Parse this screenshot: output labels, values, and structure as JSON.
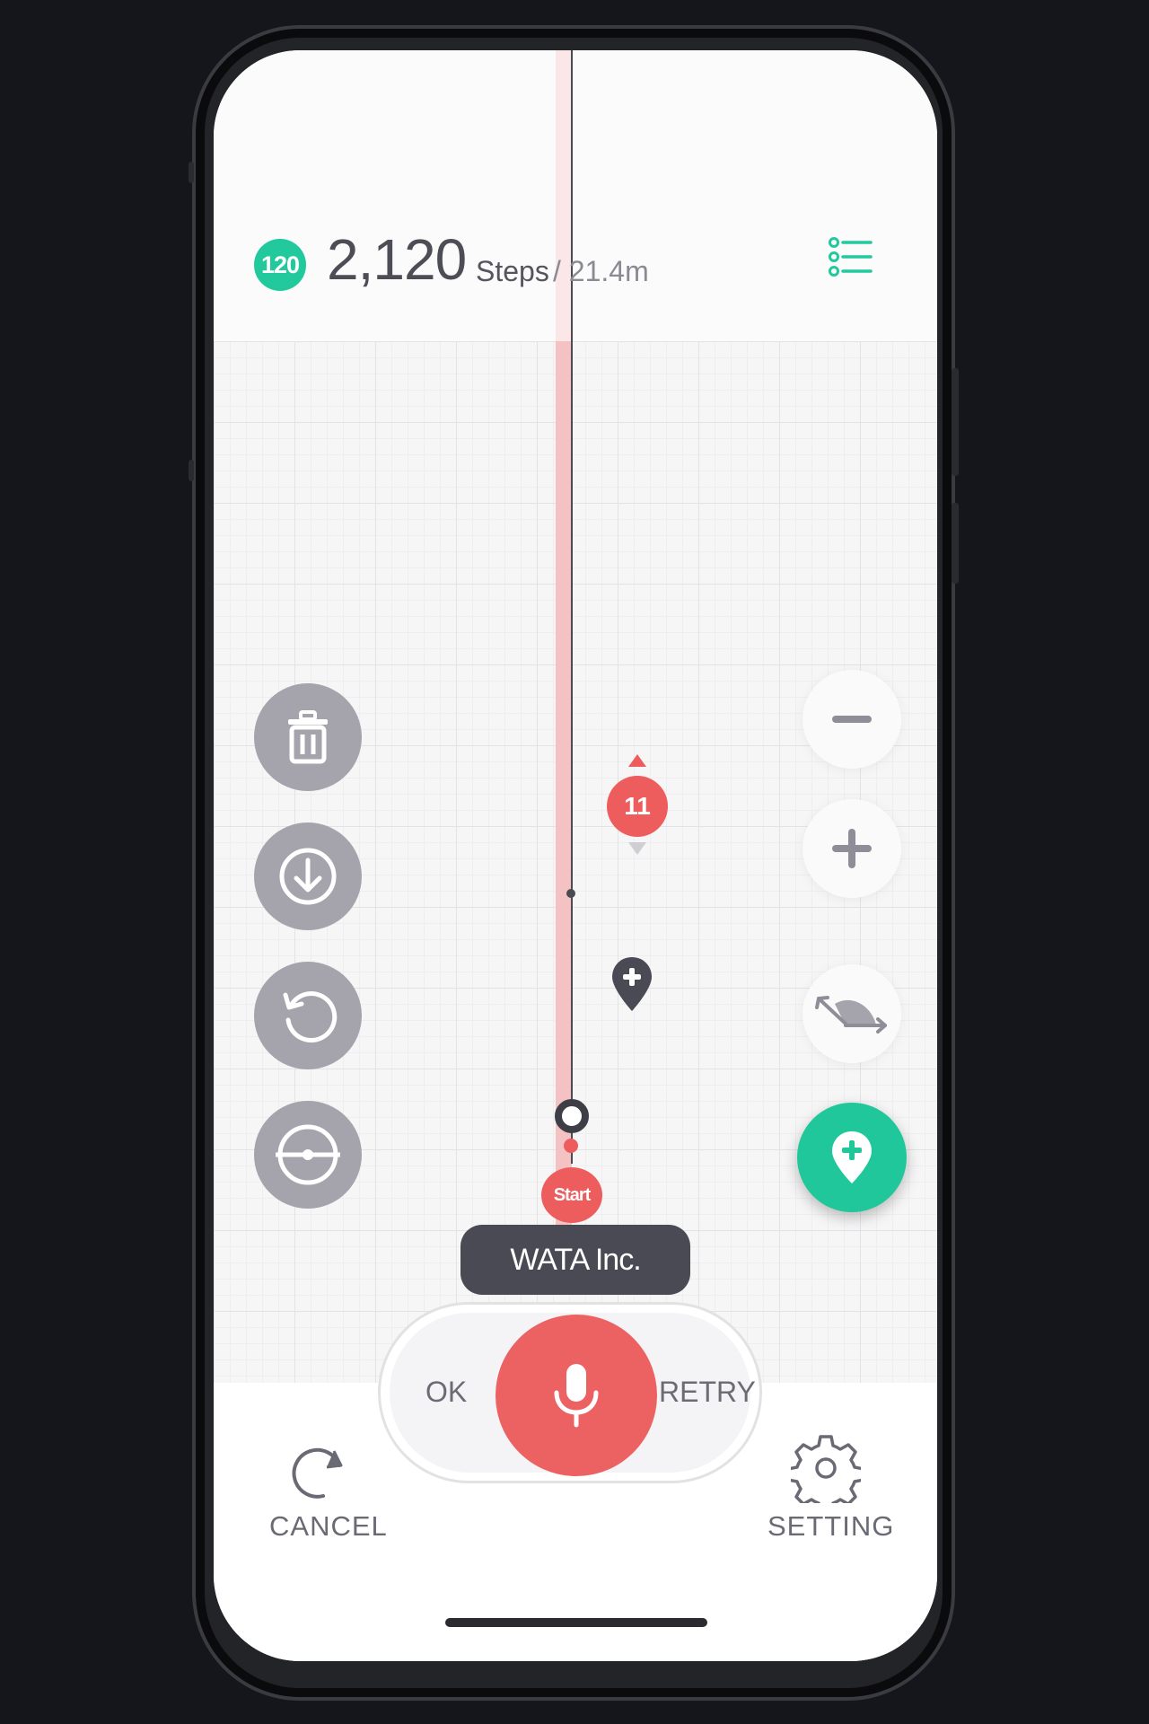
{
  "header": {
    "badge_count": "120",
    "steps_value": "2,120",
    "steps_label": "Steps",
    "distance": "/ 21.4m"
  },
  "map": {
    "waypoint_number": "11",
    "start_label": "Start",
    "location_tooltip": "WATA Inc."
  },
  "voice": {
    "ok_label": "OK",
    "retry_label": "RETRY"
  },
  "bottom": {
    "cancel_label": "CANCEL",
    "setting_label": "SETTING"
  },
  "colors": {
    "accent_green": "#21c99c",
    "route_red": "#ee5d5d",
    "mic_red": "#ec6262",
    "tool_gray": "#a5a4ad"
  },
  "icons": [
    "list-icon",
    "trash-icon",
    "download-icon",
    "undo-icon",
    "level-icon",
    "minus-icon",
    "plus-icon",
    "rotate-arrows-icon",
    "add-pin-icon",
    "mic-icon",
    "redo-icon",
    "gear-icon"
  ]
}
